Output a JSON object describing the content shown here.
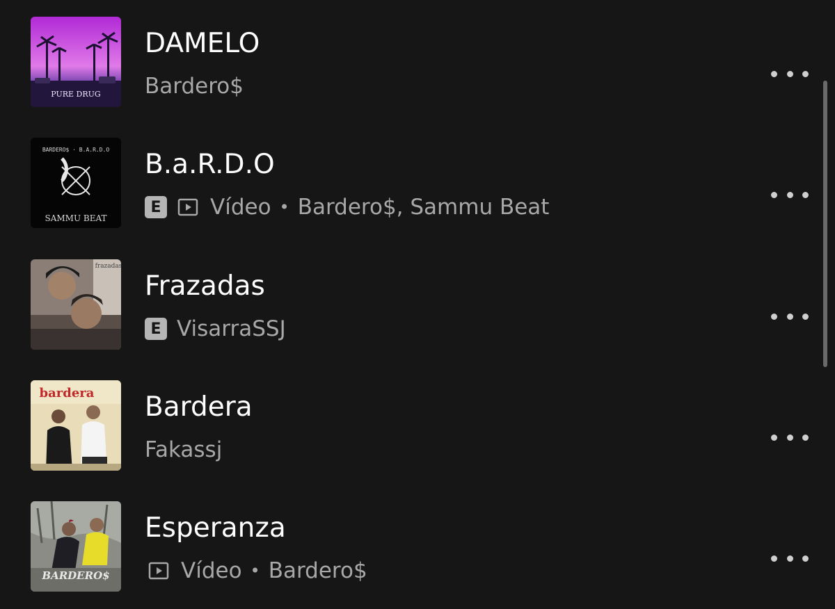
{
  "tracks": [
    {
      "title": "DAMELO",
      "explicit": false,
      "is_video": false,
      "video_label": "",
      "artists": "Bardero$",
      "cover_text": "PURE DRUG",
      "more_icon": "more-horizontal-icon"
    },
    {
      "title": "B.a.R.D.O",
      "explicit": true,
      "explicit_label": "E",
      "is_video": true,
      "video_label": "Vídeo",
      "artists": "Bardero$, Sammu Beat",
      "cover_text": "BARDERO$ · B.A.R.D.O",
      "cover_text2": "SAMMU BEAT",
      "more_icon": "more-horizontal-icon"
    },
    {
      "title": "Frazadas",
      "explicit": true,
      "explicit_label": "E",
      "is_video": false,
      "video_label": "",
      "artists": "VisarraSSJ",
      "cover_text": "frazadas",
      "more_icon": "more-horizontal-icon"
    },
    {
      "title": "Bardera",
      "explicit": false,
      "is_video": false,
      "video_label": "",
      "artists": "Fakassj",
      "cover_text": "bardera",
      "more_icon": "more-horizontal-icon"
    },
    {
      "title": "Esperanza",
      "explicit": false,
      "is_video": true,
      "video_label": "Vídeo",
      "artists": "Bardero$",
      "cover_text": "BARDERO$",
      "more_icon": "more-horizontal-icon"
    }
  ],
  "separator": "•",
  "colors": {
    "background": "#161616",
    "title": "#ffffff",
    "secondary": "#a8a8a8",
    "badge": "#b5b5b5"
  }
}
